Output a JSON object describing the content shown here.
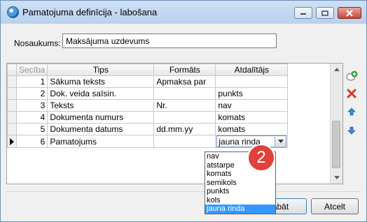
{
  "window": {
    "title": "Pamatojuma definīcija - labošana"
  },
  "form": {
    "name_label": "Nosaukums:",
    "name_value": "Maksājuma uzdevums"
  },
  "grid": {
    "headers": {
      "seq": "Secība",
      "tips": "Tips",
      "format": "Formāts",
      "separator": "Atdalītājs"
    },
    "rows": [
      {
        "seq": "1",
        "tips": "Sākuma teksts",
        "format": "Apmaksa par",
        "separator": ""
      },
      {
        "seq": "2",
        "tips": "Dok. veida saīsin.",
        "format": "",
        "separator": "punkts"
      },
      {
        "seq": "3",
        "tips": "Teksts",
        "format": "Nr.",
        "separator": "nav"
      },
      {
        "seq": "4",
        "tips": "Dokumenta numurs",
        "format": "",
        "separator": "komats"
      },
      {
        "seq": "5",
        "tips": "Dokumenta datums",
        "format": "dd.mm.yy",
        "separator": "komats"
      },
      {
        "seq": "6",
        "tips": "Pamatojums",
        "format": "",
        "separator": "jauna rinda"
      }
    ]
  },
  "dropdown": {
    "options": [
      "nav",
      "atstarpe",
      "komats",
      "semikols",
      "punkts",
      "kols",
      "jauna rinda"
    ],
    "selected": "jauna rinda"
  },
  "buttons": {
    "save": "Saglabāt",
    "save_visible": "abāt",
    "cancel": "Atcelt"
  },
  "badge": {
    "number": "2"
  },
  "icons": {
    "add": "add-row-icon",
    "delete": "delete-row-icon",
    "up": "move-up-icon",
    "down": "move-down-icon"
  }
}
